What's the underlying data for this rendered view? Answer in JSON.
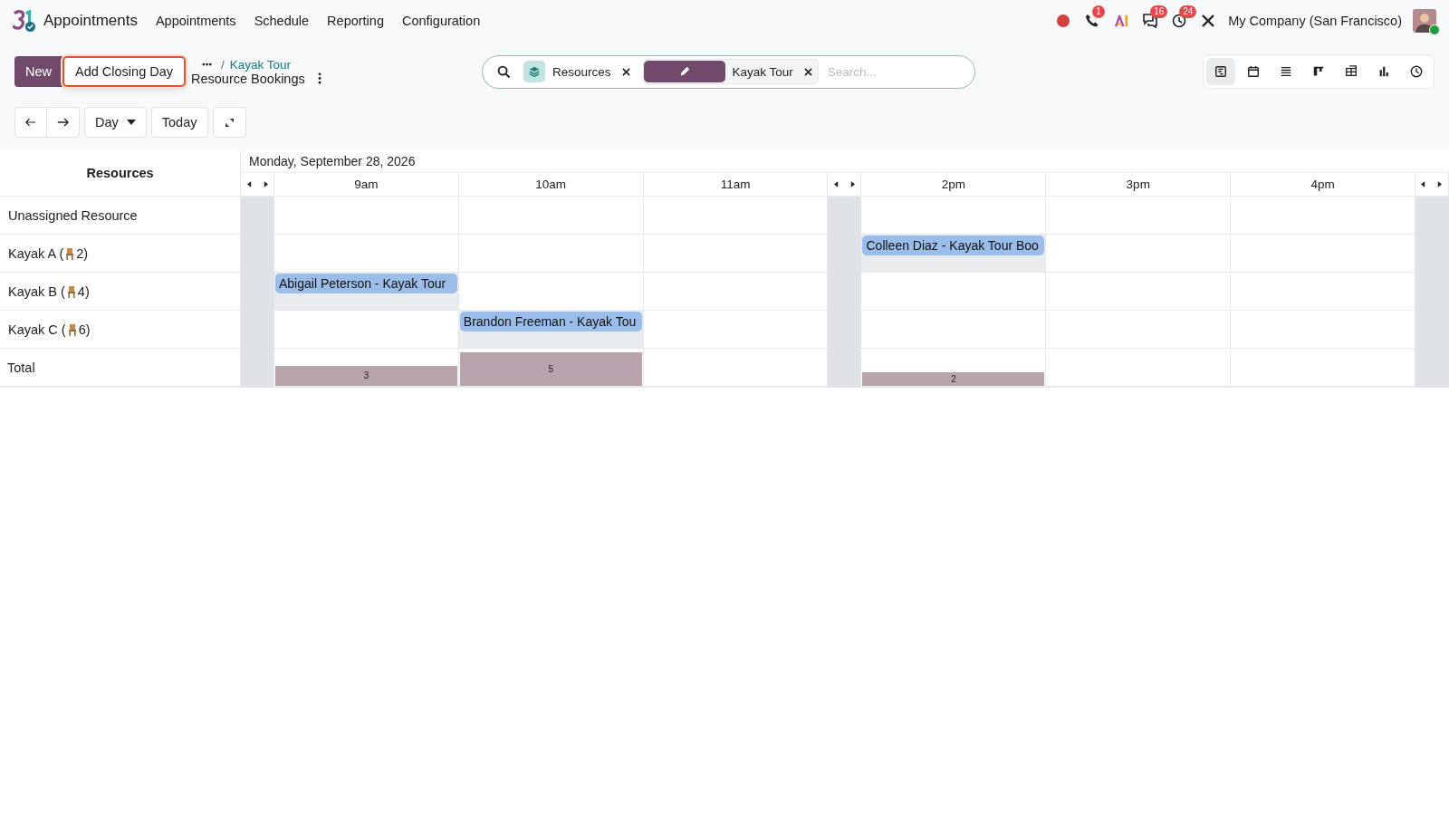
{
  "navbar": {
    "app_name": "Appointments",
    "menu": [
      "Appointments",
      "Schedule",
      "Reporting",
      "Configuration"
    ],
    "systray": [
      {
        "kind": "record"
      },
      {
        "kind": "phone",
        "badge": "1"
      },
      {
        "kind": "ai"
      },
      {
        "kind": "chat",
        "badge": "16"
      },
      {
        "kind": "activity",
        "badge": "24"
      },
      {
        "kind": "tools"
      }
    ],
    "company": "My Company (San Francisco)",
    "user_online": true
  },
  "control_panel": {
    "new_button": "New",
    "closing_day_button": "Add Closing Day",
    "breadcrumb_separator": "/",
    "breadcrumb_parent": "Kayak Tour",
    "breadcrumb_current": "Resource Bookings"
  },
  "search": {
    "facets": [
      {
        "kind": "group",
        "label": "Resources"
      },
      {
        "kind": "filter",
        "label": "Kayak Tour"
      }
    ],
    "placeholder": "Search..."
  },
  "views": [
    {
      "kind": "gantt",
      "selected": true
    },
    {
      "kind": "calendar",
      "selected": false
    },
    {
      "kind": "list",
      "selected": false
    },
    {
      "kind": "kanban",
      "selected": false
    },
    {
      "kind": "pivot",
      "selected": false
    },
    {
      "kind": "graph",
      "selected": false
    },
    {
      "kind": "activity",
      "selected": false
    }
  ],
  "navigation": {
    "period": "Day",
    "today": "Today"
  },
  "gantt": {
    "resource_header": "Resources",
    "date": "Monday, September 28, 2026",
    "total_label": "Total",
    "columns": [
      {
        "kind": "gap"
      },
      {
        "kind": "hour",
        "label": "9am",
        "total": "3"
      },
      {
        "kind": "hour",
        "label": "10am",
        "total": "5"
      },
      {
        "kind": "hour",
        "label": "11am"
      },
      {
        "kind": "gap"
      },
      {
        "kind": "hour",
        "label": "2pm",
        "total": "2"
      },
      {
        "kind": "hour",
        "label": "3pm"
      },
      {
        "kind": "hour",
        "label": "4pm"
      },
      {
        "kind": "gap"
      }
    ],
    "rows": [
      {
        "kind": "plain",
        "label": "Unassigned Resource",
        "slots": [
          {
            "booked": false
          },
          {
            "booked": false
          },
          {
            "booked": false
          },
          {
            "booked": false
          },
          {
            "booked": false
          },
          {
            "booked": false
          }
        ]
      },
      {
        "kind": "capacity",
        "label_before": "Kayak A (",
        "label_after": "2)",
        "slots": [
          {
            "booked": false
          },
          {
            "booked": false
          },
          {
            "booked": false
          },
          {
            "booked": true,
            "text": "Colleen Diaz - Kayak Tour Boo"
          },
          {
            "booked": false
          },
          {
            "booked": false
          }
        ]
      },
      {
        "kind": "capacity",
        "label_before": "Kayak B (",
        "label_after": "4)",
        "slots": [
          {
            "booked": true,
            "text": "Abigail Peterson - Kayak Tour"
          },
          {
            "booked": false
          },
          {
            "booked": false
          },
          {
            "booked": false
          },
          {
            "booked": false
          },
          {
            "booked": false
          }
        ]
      },
      {
        "kind": "capacity",
        "label_before": "Kayak C (",
        "label_after": "6)",
        "slots": [
          {
            "booked": false
          },
          {
            "booked": true,
            "text": "Brandon Freeman - Kayak Tou"
          },
          {
            "booked": false
          },
          {
            "booked": false
          },
          {
            "booked": false
          },
          {
            "booked": false
          }
        ]
      }
    ]
  }
}
